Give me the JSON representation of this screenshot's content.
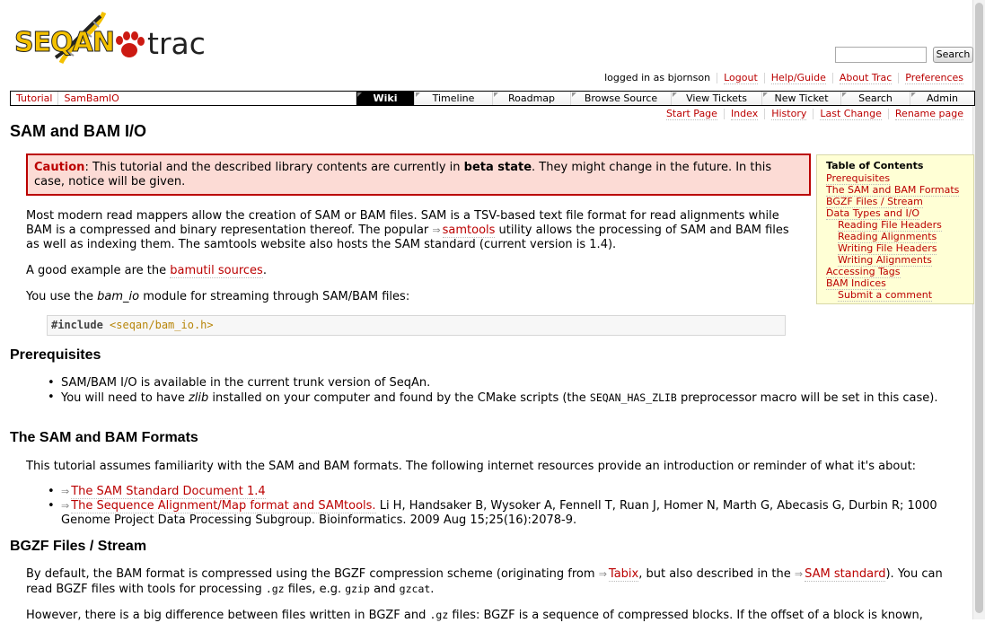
{
  "header": {
    "logo_text_left": "SEQAN",
    "logo_text_right": "trac",
    "search_placeholder": "",
    "search_button": "Search"
  },
  "metanav": {
    "logged_in": "logged in as bjornson",
    "items": [
      "Logout",
      "Help/Guide",
      "About Trac",
      "Preferences"
    ]
  },
  "mainnav": {
    "left": [
      "Tutorial",
      "SamBamIO"
    ],
    "tabs": [
      "Wiki",
      "Timeline",
      "Roadmap",
      "Browse Source",
      "View Tickets",
      "New Ticket",
      "Search",
      "Admin"
    ],
    "active": "Wiki"
  },
  "ctxnav": [
    "Start Page",
    "Index",
    "History",
    "Last Change",
    "Rename page"
  ],
  "page": {
    "title": "SAM and BAM I/O",
    "caution": {
      "label": "Caution",
      "text_a": ": This tutorial and the described library contents are currently in ",
      "beta": "beta state",
      "text_b": ". They might change in the future. In this case, notice will be given."
    },
    "intro": {
      "a": "Most modern read mappers allow the creation of SAM or BAM files. SAM is a TSV-based text file format for read alignments while BAM is a compressed and binary representation thereof. The popular ",
      "link": "samtools",
      "b": " utility allows the processing of SAM and BAM files as well as indexing them. The samtools website also hosts the SAM standard (current version is 1.4)."
    },
    "example": {
      "a": "A good example are the ",
      "link": "bamutil sources",
      "b": "."
    },
    "module": {
      "a": "You use the ",
      "em": "bam_io",
      "b": " module for streaming through SAM/BAM files:"
    },
    "code": {
      "kw": "#include",
      "str": "<seqan/bam_io.h>"
    },
    "prereq": {
      "heading": "Prerequisites",
      "item1": "SAM/BAM I/O is available in the current trunk version of SeqAn.",
      "item2_a": "You will need to have ",
      "item2_em": "zlib",
      "item2_b": " installed on your computer and found by the CMake scripts (the ",
      "item2_code": "SEQAN_HAS_ZLIB",
      "item2_c": " preprocessor macro will be set in this case)."
    },
    "formats": {
      "heading": "The SAM and BAM Formats",
      "intro": "This tutorial assumes familiarity with the SAM and BAM formats. The following internet resources provide an introduction or reminder of what it's about:",
      "link1": "The SAM Standard Document 1.4",
      "link2": "The Sequence Alignment/Map format and SAMtools.",
      "ref": " Li H, Handsaker B, Wysoker A, Fennell T, Ruan J, Homer N, Marth G, Abecasis G, Durbin R; 1000 Genome Project Data Processing Subgroup. Bioinformatics. 2009 Aug 15;25(16):2078-9."
    },
    "bgzf": {
      "heading": "BGZF Files / Stream",
      "p1_a": "By default, the BAM format is compressed using the BGZF compression scheme (originating from ",
      "p1_link1": "Tabix",
      "p1_b": ", but also described in the ",
      "p1_link2": "SAM standard",
      "p1_c": "). You can read BGZF files with tools for processing ",
      "p1_code1": ".gz",
      "p1_d": " files, e.g. ",
      "p1_code2": "gzip",
      "p1_e": " and ",
      "p1_code3": "gzcat",
      "p1_f": ".",
      "p2_a": "However, there is a big difference between files written in BGZF and ",
      "p2_code": ".gz",
      "p2_b": " files: BGZF is a sequence of compressed blocks. If the offset of a block is known,"
    }
  },
  "toc": {
    "title": "Table of Contents",
    "items": [
      {
        "label": "Prerequisites",
        "sub": false
      },
      {
        "label": "The SAM and BAM Formats",
        "sub": false
      },
      {
        "label": "BGZF Files / Stream",
        "sub": false
      },
      {
        "label": "Data Types and I/O",
        "sub": false
      },
      {
        "label": "Reading File Headers",
        "sub": true
      },
      {
        "label": "Reading Alignments",
        "sub": true
      },
      {
        "label": "Writing File Headers",
        "sub": true
      },
      {
        "label": "Writing Alignments",
        "sub": true
      },
      {
        "label": "Accessing Tags",
        "sub": false
      },
      {
        "label": "BAM Indices",
        "sub": false
      },
      {
        "label": "Submit a comment",
        "sub": true
      }
    ]
  },
  "icons": {
    "external_link": "⇒"
  },
  "colors": {
    "link": "#bb0000",
    "caution_bg": "#fcdbd5",
    "toc_bg": "#ffffd5"
  }
}
